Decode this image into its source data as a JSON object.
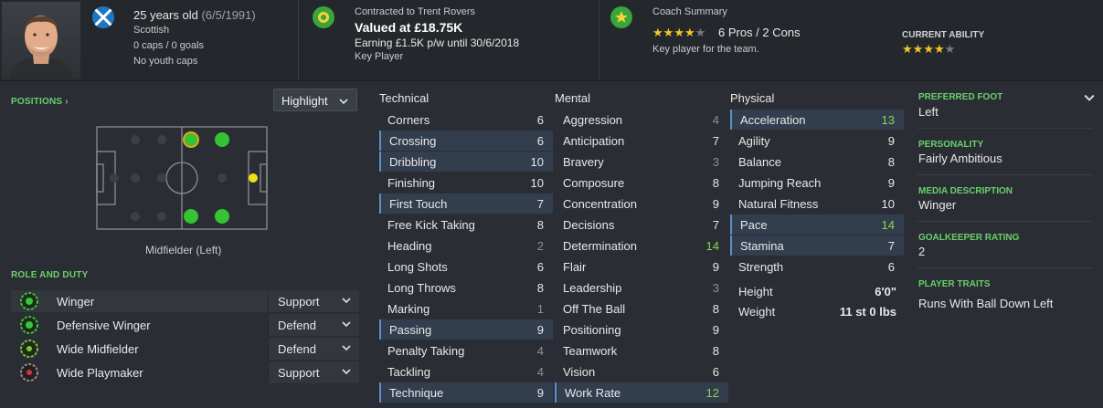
{
  "header": {
    "age_line": "25 years old",
    "dob": "(6/5/1991)",
    "nationality": "Scottish",
    "caps": "0 caps / 0 goals",
    "youth": "No youth caps",
    "contract_label": "Contracted to Trent Rovers",
    "value": "Valued at £18.75K",
    "earning": "Earning £1.5K p/w until 30/6/2018",
    "status": "Key Player",
    "coach_label": "Coach Summary",
    "coach_rating": "6 Pros / 2 Cons",
    "coach_desc": "Key player for the team.",
    "coach_stars": 3.5,
    "current_ability_label": "CURRENT ABILITY",
    "current_ability_stars": 3.5,
    "colors": {
      "flag_blue": "#1d78c4",
      "club_green": "#3aa53a",
      "star": "#f3c623"
    }
  },
  "positions": {
    "title": "POSITIONS",
    "dropdown": "Highlight",
    "position_label": "Midfielder (Left)"
  },
  "roles": {
    "title": "ROLE AND DUTY",
    "items": [
      {
        "name": "Winger",
        "duty": "Support",
        "rating": "full"
      },
      {
        "name": "Defensive Winger",
        "duty": "Defend",
        "rating": "full"
      },
      {
        "name": "Wide Midfielder",
        "duty": "Defend",
        "rating": "high"
      },
      {
        "name": "Wide Playmaker",
        "duty": "Support",
        "rating": "low"
      }
    ]
  },
  "technical": {
    "title": "Technical",
    "rows": [
      {
        "name": "Corners",
        "value": "6"
      },
      {
        "name": "Crossing",
        "value": "6"
      },
      {
        "name": "Dribbling",
        "value": "10"
      },
      {
        "name": "Finishing",
        "value": "10"
      },
      {
        "name": "First Touch",
        "value": "7"
      },
      {
        "name": "Free Kick Taking",
        "value": "8"
      },
      {
        "name": "Heading",
        "value": "2"
      },
      {
        "name": "Long Shots",
        "value": "6"
      },
      {
        "name": "Long Throws",
        "value": "8"
      },
      {
        "name": "Marking",
        "value": "1"
      },
      {
        "name": "Passing",
        "value": "9"
      },
      {
        "name": "Penalty Taking",
        "value": "4"
      },
      {
        "name": "Tackling",
        "value": "4"
      },
      {
        "name": "Technique",
        "value": "9"
      }
    ]
  },
  "mental": {
    "title": "Mental",
    "rows": [
      {
        "name": "Aggression",
        "value": "4"
      },
      {
        "name": "Anticipation",
        "value": "7"
      },
      {
        "name": "Bravery",
        "value": "3"
      },
      {
        "name": "Composure",
        "value": "8"
      },
      {
        "name": "Concentration",
        "value": "9"
      },
      {
        "name": "Decisions",
        "value": "7"
      },
      {
        "name": "Determination",
        "value": "14"
      },
      {
        "name": "Flair",
        "value": "9"
      },
      {
        "name": "Leadership",
        "value": "3"
      },
      {
        "name": "Off The Ball",
        "value": "8"
      },
      {
        "name": "Positioning",
        "value": "9"
      },
      {
        "name": "Teamwork",
        "value": "8"
      },
      {
        "name": "Vision",
        "value": "6"
      },
      {
        "name": "Work Rate",
        "value": "12"
      }
    ]
  },
  "physical": {
    "title": "Physical",
    "rows": [
      {
        "name": "Acceleration",
        "value": "13"
      },
      {
        "name": "Agility",
        "value": "9"
      },
      {
        "name": "Balance",
        "value": "8"
      },
      {
        "name": "Jumping Reach",
        "value": "9"
      },
      {
        "name": "Natural Fitness",
        "value": "10"
      },
      {
        "name": "Pace",
        "value": "14"
      },
      {
        "name": "Stamina",
        "value": "7"
      },
      {
        "name": "Strength",
        "value": "6"
      }
    ],
    "height_label": "Height",
    "height_value": "6'0\"",
    "weight_label": "Weight",
    "weight_value": "11 st 0 lbs"
  },
  "info": {
    "foot_title": "PREFERRED FOOT",
    "foot_value": "Left",
    "personality_title": "PERSONALITY",
    "personality_value": "Fairly Ambitious",
    "media_title": "MEDIA DESCRIPTION",
    "media_value": "Winger",
    "gk_title": "GOALKEEPER RATING",
    "gk_value": "2",
    "traits_title": "PLAYER TRAITS",
    "traits_value": "Runs With Ball Down Left"
  }
}
